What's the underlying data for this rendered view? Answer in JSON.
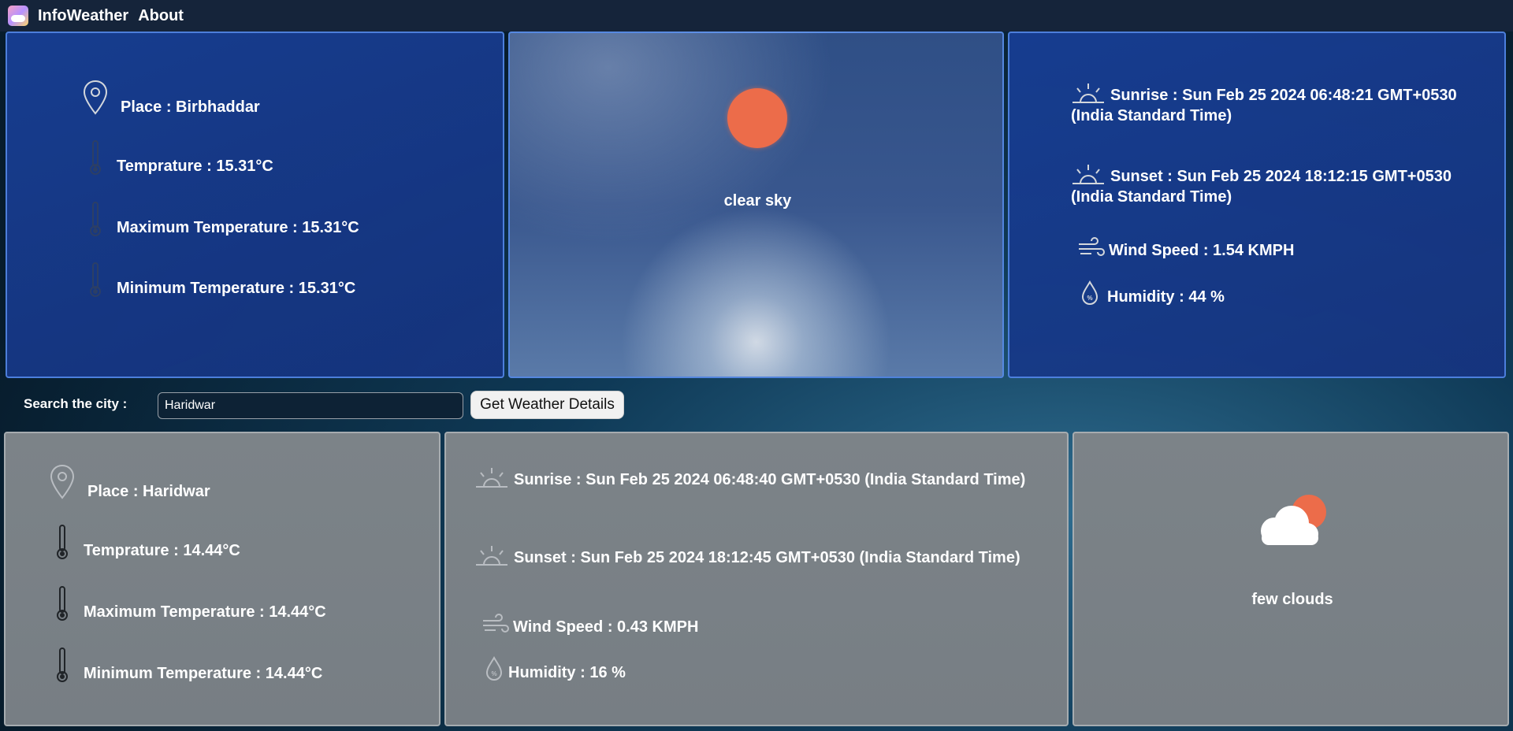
{
  "nav": {
    "brand": "InfoWeather",
    "about": "About"
  },
  "current": {
    "place": "Place : Birbhaddar",
    "temp": "Temprature : 15.31°C",
    "max_temp": "Maximum Temperature : 15.31°C",
    "min_temp": "Minimum Temperature : 15.31°C",
    "description": "clear sky",
    "sunrise": "Sunrise : Sun Feb 25 2024 06:48:21 GMT+0530 (India Standard Time)",
    "sunset": "Sunset : Sun Feb 25 2024 18:12:15 GMT+0530 (India Standard Time)",
    "wind": "Wind Speed : 1.54 KMPH",
    "humidity": "Humidity : 44 %"
  },
  "search": {
    "label": "Search the city :",
    "value": "Haridwar",
    "button": "Get Weather Details"
  },
  "searched": {
    "place": "Place : Haridwar",
    "temp": "Temprature : 14.44°C",
    "max_temp": "Maximum Temperature : 14.44°C",
    "min_temp": "Minimum Temperature : 14.44°C",
    "sunrise": "Sunrise : Sun Feb 25 2024 06:48:40 GMT+0530 (India Standard Time)",
    "sunset": "Sunset : Sun Feb 25 2024 18:12:45 GMT+0530 (India Standard Time)",
    "wind": "Wind Speed : 0.43 KMPH",
    "humidity": "Humidity : 16 %",
    "description": "few clouds"
  },
  "icons": {
    "place": "map-pin-icon",
    "temperature": "thermometer-icon",
    "sunrise": "sunrise-icon",
    "sunset": "sunset-icon",
    "wind": "wind-icon",
    "humidity": "droplet-icon",
    "weather_current": "clear-sky-sun-icon",
    "weather_searched": "few-clouds-icon"
  },
  "colors": {
    "navbar": "#15243a",
    "card_blue": "#183f96",
    "card_grey": "#7c8388",
    "sun": "#ec6c4a",
    "button_bg": "#f1f1f1"
  }
}
